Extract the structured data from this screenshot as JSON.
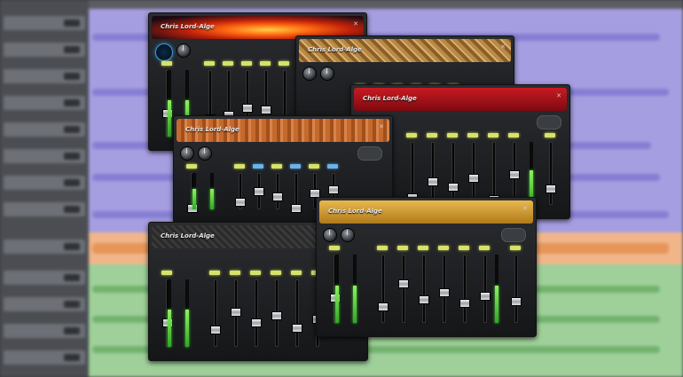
{
  "plugins": [
    {
      "id": "p1",
      "brand": "Chris Lord-Alge",
      "header_style": "fire",
      "faders": 6
    },
    {
      "id": "p2",
      "brand": "Chris Lord-Alge",
      "header_style": "snake",
      "faders": 6
    },
    {
      "id": "p3",
      "brand": "Chris Lord-Alge",
      "header_style": "red",
      "faders": 6
    },
    {
      "id": "p4",
      "brand": "Chris Lord-Alge",
      "header_style": "wood",
      "faders": 6
    },
    {
      "id": "p5",
      "brand": "Chris Lord-Alge",
      "header_style": "carbon",
      "faders": 6
    },
    {
      "id": "p6",
      "brand": "Chris Lord-Alge",
      "header_style": "gold",
      "faders": 6
    }
  ],
  "icons": {
    "close": "close-icon",
    "knob": "knob-icon"
  },
  "colors": {
    "lane_purple": "#a59ee0",
    "lane_orange": "#f0b68a",
    "lane_green": "#9fd09a",
    "meter_green": "#4ad838",
    "sticker_yellow": "#d6e26a",
    "sticker_blue": "#6ab2e8"
  }
}
